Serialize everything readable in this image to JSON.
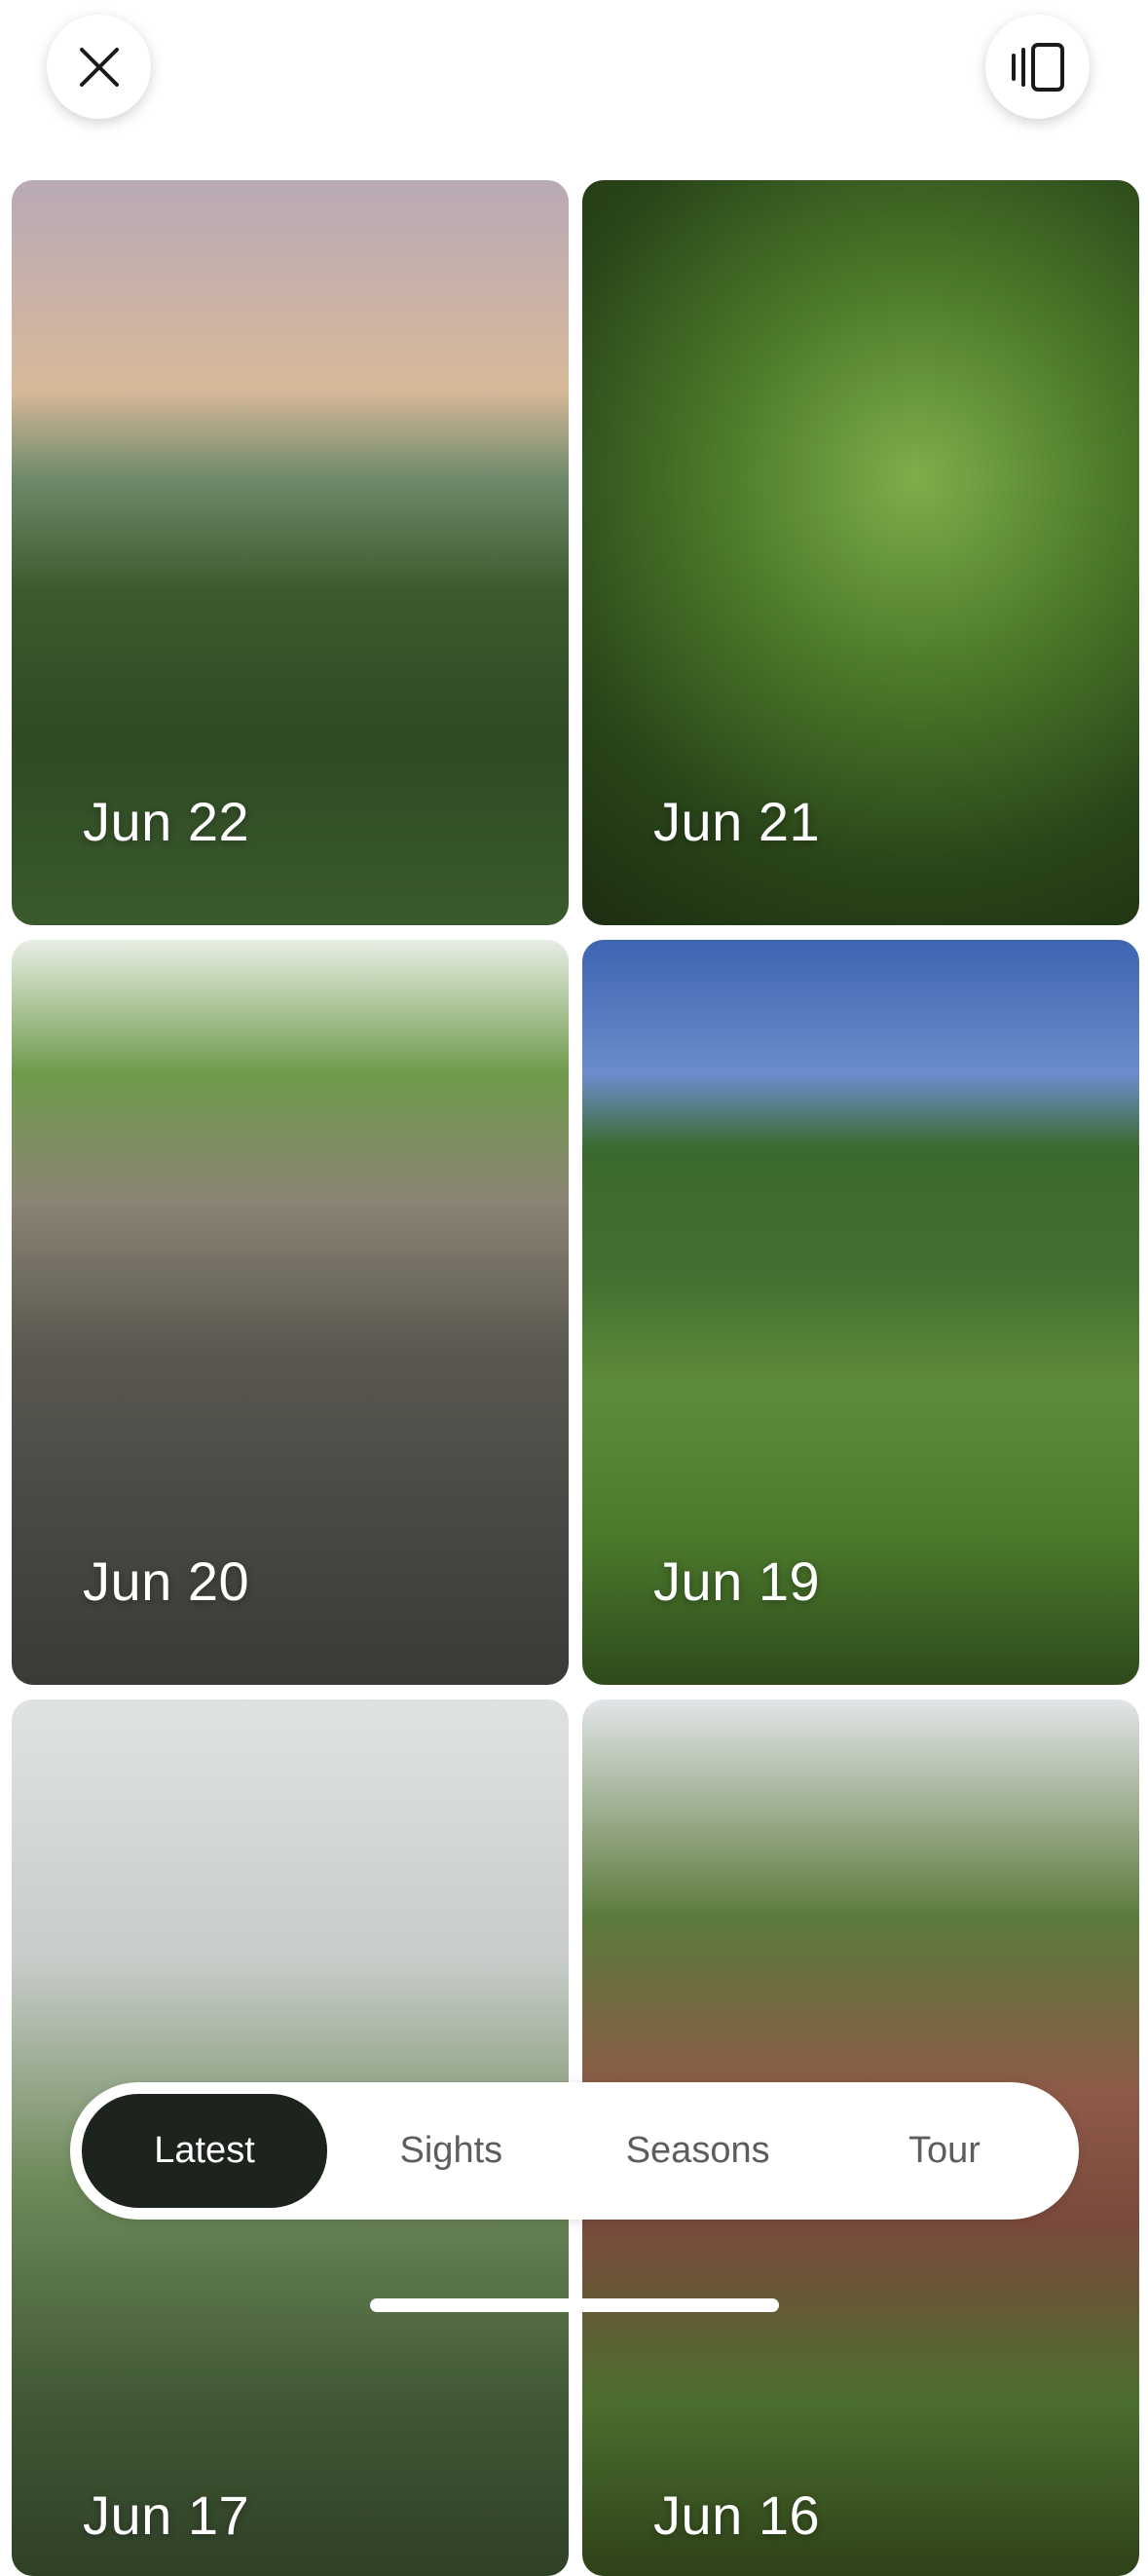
{
  "header": {
    "close_icon": "close-icon",
    "layout_icon": "swipe-cards-icon"
  },
  "photos": [
    {
      "date": "Jun 22"
    },
    {
      "date": "Jun 21"
    },
    {
      "date": "Jun 20"
    },
    {
      "date": "Jun 19"
    },
    {
      "date": "Jun 17"
    },
    {
      "date": "Jun 16"
    }
  ],
  "tabs": [
    {
      "label": "Latest",
      "active": true
    },
    {
      "label": "Sights",
      "active": false
    },
    {
      "label": "Seasons",
      "active": false
    },
    {
      "label": "Tour",
      "active": false
    }
  ],
  "colors": {
    "active_tab_bg": "#1d231d",
    "inactive_tab_text": "#5b5f5c"
  }
}
